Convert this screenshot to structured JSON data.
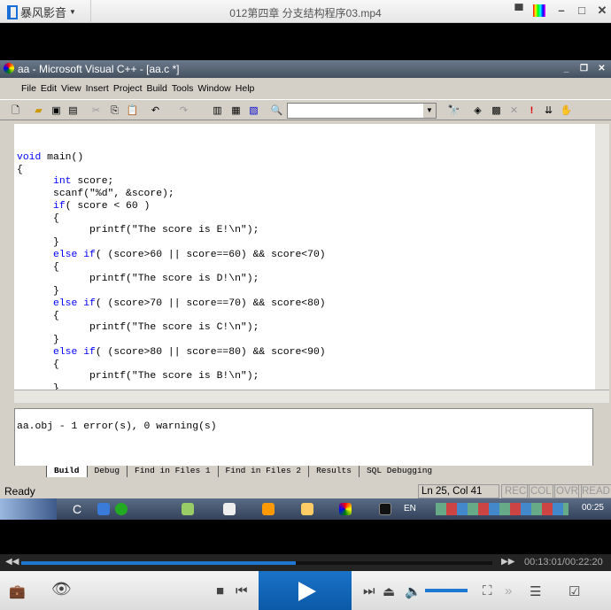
{
  "player": {
    "app_name": "暴风影音",
    "video_title": "012第四章 分支结构程序03.mp4",
    "current_time": "00:13:01",
    "total_time": "00:22:20",
    "time_display": "00:13:01/00:22:20",
    "progress_fraction": 0.583,
    "volume_fraction": 1.0,
    "accent": "#1e78d2"
  },
  "ide": {
    "title": "aa - Microsoft Visual C++ - [aa.c *]",
    "menu": [
      "File",
      "Edit",
      "View",
      "Insert",
      "Project",
      "Build",
      "Tools",
      "Window",
      "Help"
    ],
    "find_combo_value": "",
    "code_lines": [
      "",
      "void main()",
      "{",
      "\tint score;",
      "\tscanf(\"%d\", &score);",
      "\tif( score < 60 )",
      "\t{",
      "\t\tprintf(\"The score is E!\\n\");",
      "\t}",
      "\telse if( (score>60 || score==60) && score<70)",
      "\t{",
      "\t\tprintf(\"The score is D!\\n\");",
      "\t}",
      "\telse if( (score>70 || score==70) && score<80)",
      "\t{",
      "\t\tprintf(\"The score is C!\\n\");",
      "\t}",
      "\telse if( (score>80 || score==80) && score<90)",
      "\t{",
      "\t\tprintf(\"The score is B!\\n\");",
      "\t}"
    ],
    "output_text": "aa.obj - 1 error(s), 0 warning(s)",
    "output_tabs": [
      "Build",
      "Debug",
      "Find in Files 1",
      "Find in Files 2",
      "Results",
      "SQL Debugging"
    ],
    "status": {
      "ready": "Ready",
      "position": "Ln 25, Col 41",
      "indicators": [
        "REC",
        "COL",
        "OVR",
        "READ"
      ]
    },
    "taskbar": {
      "start_label": "C",
      "lang": "EN",
      "clock": "00:25"
    }
  }
}
